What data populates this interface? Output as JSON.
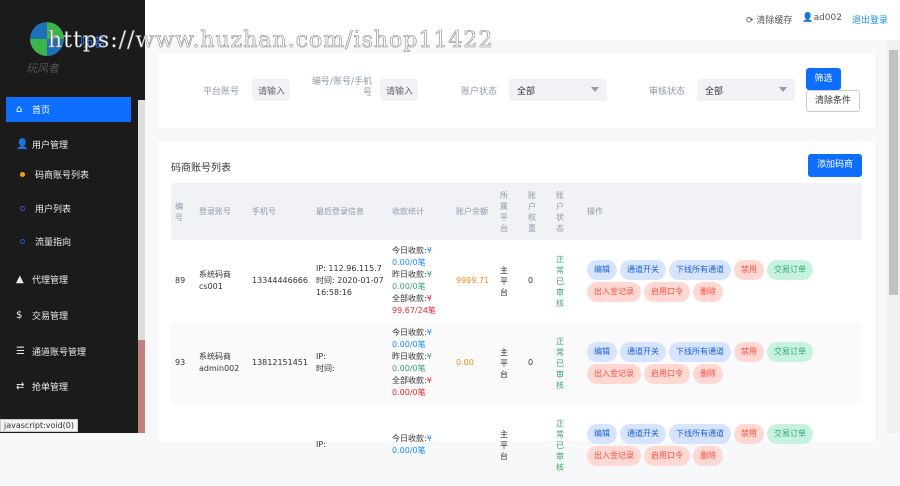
{
  "watermark": "https://www.huzhan.com/ishop11422",
  "logo": {
    "text": "呖若",
    "sub": "玩风者"
  },
  "header": {
    "clear_cache": "清除缓存",
    "user": "ad002",
    "logout": "退出登录"
  },
  "sidebar": {
    "items": [
      {
        "label": "首页",
        "icon": "home-icon"
      },
      {
        "label": "用户管理",
        "icon": "user-icon"
      },
      {
        "label": "码商账号列表"
      },
      {
        "label": "用户列表"
      },
      {
        "label": "流量指向"
      },
      {
        "label": "代理管理",
        "icon": "bell-icon"
      },
      {
        "label": "交易管理",
        "icon": "dollar-icon"
      },
      {
        "label": "通道账号管理",
        "icon": "list-icon"
      },
      {
        "label": "抢单管理",
        "icon": "exchange-icon"
      }
    ]
  },
  "status_tip": "javascript:void(0)",
  "filter": {
    "platform_label": "平台账号",
    "platform_placeholder": "请输入",
    "id_label": "编号/账号/手机号",
    "id_placeholder": "请输入",
    "acct_status_label": "账户状态",
    "acct_status_value": "全部",
    "audit_label": "审核状态",
    "audit_value": "全部",
    "filter_btn": "筛选",
    "clear_btn": "清除条件"
  },
  "list": {
    "title": "码商账号列表",
    "add_btn": "添加码商",
    "headers": [
      "编号",
      "登录账号",
      "手机号",
      "最后登录信息",
      "收款统计",
      "账户余额",
      "所属平台",
      "账户权重",
      "账户状态",
      "操作"
    ],
    "stat_labels": {
      "today": "今日收款:",
      "yesterday": "昨日收款:",
      "all": "全部收款:",
      "yen": "¥"
    },
    "actions": [
      "编辑",
      "通道开关",
      "下线所有通道",
      "禁用",
      "交易订单",
      "出入金记录",
      "启用口令",
      "删除"
    ],
    "rows": [
      {
        "id": "89",
        "name": "系统码商",
        "account": "cs001",
        "phone": "13344446666",
        "ip": "IP: 112.96.115.7",
        "time": "时间: 2020-01-07 16:58:16",
        "today": "0.00/0笔",
        "yesterday": "0.00/0笔",
        "all": "99.67/24笔",
        "balance": "9999.71",
        "platform": "主平台",
        "weight": "0",
        "status": "正常已审核"
      },
      {
        "id": "93",
        "name": "系统码商",
        "account": "admin002",
        "phone": "13812151451",
        "ip": "IP:",
        "time": "时间:",
        "today": "0.00/0笔",
        "yesterday": "0.00/0笔",
        "all": "0.00/0笔",
        "balance": "0.00",
        "platform": "主平台",
        "weight": "0",
        "status": "正常已审核"
      },
      {
        "id": "",
        "name": "",
        "account": "",
        "phone": "",
        "ip": "IP:",
        "time": "",
        "today": "0.00/0笔",
        "yesterday": "",
        "all": "",
        "balance": "",
        "platform": "主平台",
        "weight": "",
        "status": "正常已审核"
      }
    ]
  }
}
